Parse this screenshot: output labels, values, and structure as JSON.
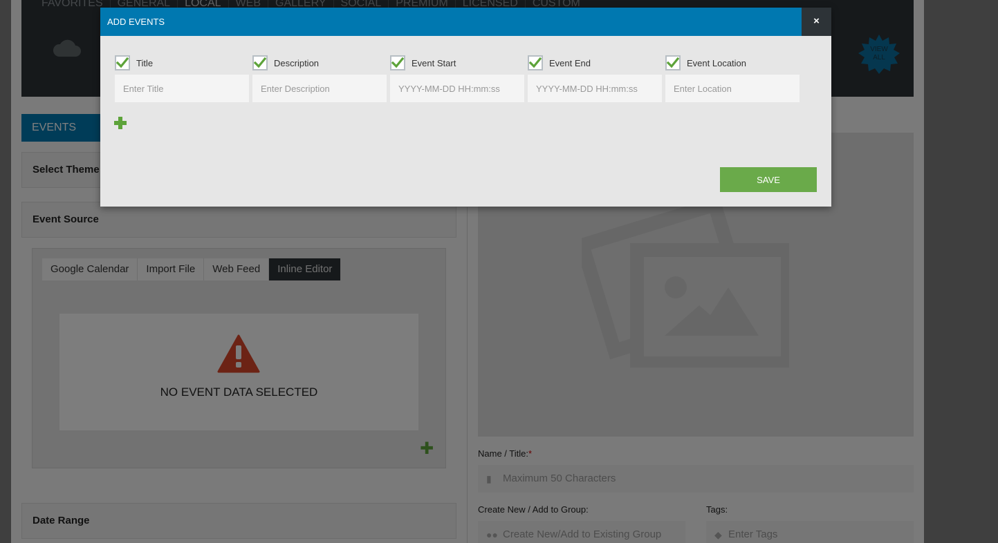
{
  "top_nav": [
    "FAVORITES",
    "GENERAL",
    "LOCAL",
    "WEB",
    "GALLERY",
    "SOCIAL",
    "PREMIUM",
    "LICENSED",
    "CUSTOM"
  ],
  "view_all": [
    "VIEW",
    "ALL"
  ],
  "events_tab": "EVENTS",
  "panels": {
    "select_theme": "Select Theme",
    "event_source": "Event Source",
    "date_range": "Date Range"
  },
  "source_tabs": [
    "Google Calendar",
    "Import File",
    "Web Feed",
    "Inline Editor"
  ],
  "no_data_text": "NO EVENT DATA SELECTED",
  "form": {
    "name_label": "Name / Title:",
    "name_required": "*",
    "name_placeholder": "Maximum 50 Characters",
    "group_label": "Create New / Add to Group:",
    "group_placeholder": "Create New/Add to Existing Group",
    "tags_label": "Tags:",
    "tags_placeholder": "Enter Tags"
  },
  "modal": {
    "title": "ADD EVENTS",
    "close": "×",
    "columns": [
      {
        "label": "Title",
        "checked": true,
        "placeholder": "Enter Title"
      },
      {
        "label": "Description",
        "checked": true,
        "placeholder": "Enter Description"
      },
      {
        "label": "Event Start",
        "checked": true,
        "placeholder": "YYYY-MM-DD HH:mm:ss"
      },
      {
        "label": "Event End",
        "checked": true,
        "placeholder": "YYYY-MM-DD HH:mm:ss"
      },
      {
        "label": "Event Location",
        "checked": true,
        "placeholder": "Enter Location"
      }
    ],
    "save_label": "SAVE"
  },
  "colors": {
    "accent": "#0078b0",
    "dark": "#2d3337",
    "success": "#6aaa4a",
    "warning": "#d9472b"
  }
}
